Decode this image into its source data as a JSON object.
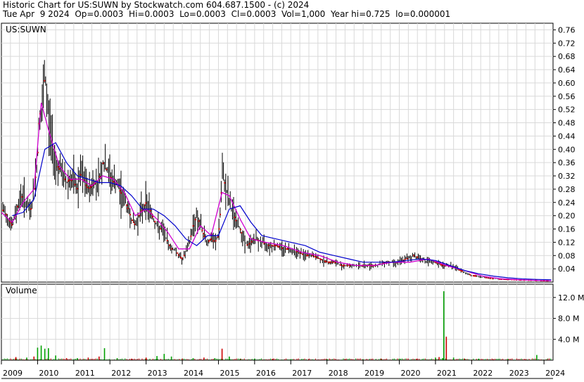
{
  "header": {
    "line1": "Historic Chart for US:SUWN by Stockwatch.com 604.687.1500 - (c) 2024",
    "line2": "Tue Apr  9 2024  Op=0.0003  Hi=0.0003  Lo=0.0003  Cl=0.0003  Vol=1,000  Year hi=0.725  lo=0.000001"
  },
  "chart_data": [
    {
      "type": "line",
      "title": "US:SUWN",
      "ylim": [
        0,
        0.78
      ],
      "xlim": [
        2009.0,
        2024.25
      ],
      "yticks": [
        "0.04",
        "0.08",
        "0.12",
        "0.16",
        "0.20",
        "0.24",
        "0.28",
        "0.32",
        "0.36",
        "0.40",
        "0.44",
        "0.48",
        "0.52",
        "0.56",
        "0.60",
        "0.64",
        "0.68",
        "0.72",
        "0.76"
      ],
      "xticks": [
        "2009",
        "2010",
        "2011",
        "2012",
        "2013",
        "2014",
        "2015",
        "2016",
        "2017",
        "2018",
        "2019",
        "2020",
        "2021",
        "2022",
        "2023",
        "2024"
      ],
      "grid": true,
      "colors": {
        "bars": "#000000",
        "close": "#cc0000",
        "ma_short": "#d000d0",
        "ma_long": "#0000cc"
      },
      "series": [
        {
          "role": "price-close",
          "x": [
            2009.0,
            2009.1,
            2009.2,
            2009.3,
            2009.4,
            2009.5,
            2009.6,
            2009.7,
            2009.8,
            2009.9,
            2010.0,
            2010.05,
            2010.1,
            2010.15,
            2010.2,
            2010.3,
            2010.4,
            2010.5,
            2010.6,
            2010.7,
            2010.8,
            2010.9,
            2011.0,
            2011.1,
            2011.2,
            2011.3,
            2011.4,
            2011.5,
            2011.6,
            2011.7,
            2011.8,
            2011.9,
            2012.0,
            2012.1,
            2012.2,
            2012.3,
            2012.4,
            2012.5,
            2012.6,
            2012.7,
            2012.8,
            2012.9,
            2013.0,
            2013.1,
            2013.2,
            2013.3,
            2013.4,
            2013.5,
            2013.6,
            2013.7,
            2013.8,
            2013.9,
            2014.0,
            2014.1,
            2014.2,
            2014.3,
            2014.4,
            2014.5,
            2014.6,
            2014.7,
            2014.8,
            2014.9,
            2015.0,
            2015.05,
            2015.1,
            2015.2,
            2015.3,
            2015.4,
            2015.5,
            2015.6,
            2015.7,
            2015.8,
            2015.9,
            2016.0,
            2016.2,
            2016.4,
            2016.6,
            2016.8,
            2017.0,
            2017.2,
            2017.4,
            2017.6,
            2017.8,
            2018.0,
            2018.2,
            2018.4,
            2018.6,
            2018.8,
            2019.0,
            2019.2,
            2019.4,
            2019.6,
            2019.8,
            2020.0,
            2020.2,
            2020.4,
            2020.6,
            2020.8,
            2021.0,
            2021.2,
            2021.4,
            2021.6,
            2021.8,
            2022.0,
            2022.3,
            2022.6,
            2023.0,
            2023.4,
            2023.8,
            2024.0,
            2024.2
          ],
          "values": [
            0.22,
            0.21,
            0.19,
            0.17,
            0.21,
            0.25,
            0.26,
            0.23,
            0.21,
            0.27,
            0.38,
            0.52,
            0.48,
            0.55,
            0.62,
            0.5,
            0.42,
            0.36,
            0.34,
            0.32,
            0.3,
            0.31,
            0.3,
            0.28,
            0.33,
            0.3,
            0.28,
            0.29,
            0.3,
            0.31,
            0.36,
            0.34,
            0.32,
            0.3,
            0.29,
            0.27,
            0.25,
            0.22,
            0.19,
            0.17,
            0.2,
            0.22,
            0.24,
            0.22,
            0.19,
            0.17,
            0.16,
            0.15,
            0.12,
            0.1,
            0.1,
            0.08,
            0.07,
            0.09,
            0.12,
            0.17,
            0.2,
            0.17,
            0.14,
            0.12,
            0.13,
            0.12,
            0.14,
            0.21,
            0.32,
            0.29,
            0.24,
            0.21,
            0.18,
            0.16,
            0.13,
            0.11,
            0.12,
            0.13,
            0.12,
            0.11,
            0.11,
            0.1,
            0.1,
            0.09,
            0.08,
            0.08,
            0.07,
            0.06,
            0.06,
            0.05,
            0.05,
            0.05,
            0.05,
            0.05,
            0.05,
            0.06,
            0.06,
            0.06,
            0.07,
            0.08,
            0.07,
            0.06,
            0.06,
            0.05,
            0.05,
            0.04,
            0.03,
            0.02,
            0.015,
            0.01,
            0.008,
            0.006,
            0.005,
            0.004,
            0.004
          ]
        },
        {
          "role": "moving-average-short",
          "x": [
            2009.0,
            2009.3,
            2009.6,
            2009.9,
            2010.1,
            2010.3,
            2010.6,
            2010.9,
            2011.2,
            2011.5,
            2011.8,
            2012.1,
            2012.4,
            2012.7,
            2013.0,
            2013.3,
            2013.6,
            2013.9,
            2014.2,
            2014.5,
            2014.8,
            2015.1,
            2015.3,
            2015.6,
            2015.9,
            2016.3,
            2016.8,
            2017.3,
            2017.8,
            2018.3,
            2018.8,
            2019.3,
            2019.8,
            2020.3,
            2020.8,
            2021.3,
            2021.8,
            2022.3,
            2022.8,
            2023.3,
            2023.8,
            2024.2
          ],
          "values": [
            0.21,
            0.18,
            0.24,
            0.28,
            0.54,
            0.46,
            0.35,
            0.31,
            0.31,
            0.29,
            0.32,
            0.31,
            0.27,
            0.2,
            0.22,
            0.19,
            0.15,
            0.1,
            0.1,
            0.17,
            0.14,
            0.27,
            0.26,
            0.19,
            0.13,
            0.12,
            0.11,
            0.09,
            0.08,
            0.06,
            0.05,
            0.05,
            0.06,
            0.06,
            0.07,
            0.05,
            0.035,
            0.018,
            0.01,
            0.007,
            0.005,
            0.004
          ]
        },
        {
          "role": "moving-average-long",
          "x": [
            2009.3,
            2009.6,
            2009.9,
            2010.2,
            2010.5,
            2010.8,
            2011.1,
            2011.4,
            2011.7,
            2012.0,
            2012.3,
            2012.6,
            2012.9,
            2013.2,
            2013.5,
            2013.8,
            2014.1,
            2014.4,
            2014.7,
            2015.0,
            2015.3,
            2015.6,
            2015.9,
            2016.2,
            2016.6,
            2017.0,
            2017.4,
            2017.8,
            2018.2,
            2018.6,
            2019.0,
            2019.4,
            2019.8,
            2020.2,
            2020.6,
            2021.0,
            2021.4,
            2021.8,
            2022.2,
            2022.6,
            2023.0,
            2023.4,
            2023.8,
            2024.2
          ],
          "values": [
            0.2,
            0.21,
            0.25,
            0.4,
            0.42,
            0.36,
            0.32,
            0.31,
            0.3,
            0.3,
            0.29,
            0.26,
            0.22,
            0.22,
            0.2,
            0.17,
            0.13,
            0.11,
            0.14,
            0.14,
            0.22,
            0.23,
            0.18,
            0.14,
            0.13,
            0.12,
            0.11,
            0.09,
            0.08,
            0.07,
            0.06,
            0.06,
            0.06,
            0.065,
            0.07,
            0.065,
            0.05,
            0.035,
            0.025,
            0.018,
            0.013,
            0.01,
            0.008,
            0.007
          ]
        }
      ]
    },
    {
      "type": "bar",
      "title": "Volume",
      "ylim": [
        0,
        14000000
      ],
      "yticks": [
        "4.0 M",
        "8.0 M",
        "12.0 M"
      ],
      "xlim": [
        2009.0,
        2024.25
      ],
      "colors": {
        "up": "#00a000",
        "down": "#cc0000"
      },
      "x": [
        2009.4,
        2009.7,
        2009.9,
        2010.0,
        2010.1,
        2010.2,
        2010.3,
        2010.5,
        2010.8,
        2011.1,
        2011.4,
        2011.7,
        2011.85,
        2012.2,
        2012.6,
        2013.0,
        2013.3,
        2013.5,
        2013.7,
        2014.0,
        2014.3,
        2014.6,
        2014.9,
        2015.1,
        2015.3,
        2015.6,
        2016.0,
        2016.5,
        2017.0,
        2017.5,
        2018.0,
        2018.5,
        2019.0,
        2019.5,
        2020.0,
        2020.5,
        2021.0,
        2021.1,
        2021.2,
        2021.23,
        2021.3,
        2021.5,
        2021.8,
        2022.2,
        2022.6,
        2023.0,
        2023.5,
        2023.8,
        2024.1
      ],
      "values": [
        600000,
        500000,
        700000,
        2400000,
        2800000,
        2200000,
        2300000,
        900000,
        400000,
        400000,
        500000,
        700000,
        2300000,
        400000,
        300000,
        500000,
        800000,
        1200000,
        700000,
        300000,
        400000,
        500000,
        400000,
        2200000,
        700000,
        300000,
        300000,
        200000,
        200000,
        200000,
        200000,
        200000,
        200000,
        300000,
        300000,
        300000,
        500000,
        600000,
        400000,
        13200000,
        4500000,
        500000,
        300000,
        300000,
        200000,
        200000,
        200000,
        1000000,
        200000
      ],
      "up": [
        false,
        true,
        false,
        true,
        true,
        true,
        true,
        true,
        false,
        true,
        false,
        false,
        true,
        true,
        false,
        false,
        true,
        true,
        true,
        false,
        true,
        false,
        true,
        false,
        true,
        true,
        true,
        false,
        true,
        false,
        true,
        false,
        true,
        false,
        true,
        false,
        true,
        false,
        true,
        true,
        false,
        true,
        false,
        true,
        false,
        true,
        false,
        true,
        false
      ]
    }
  ]
}
